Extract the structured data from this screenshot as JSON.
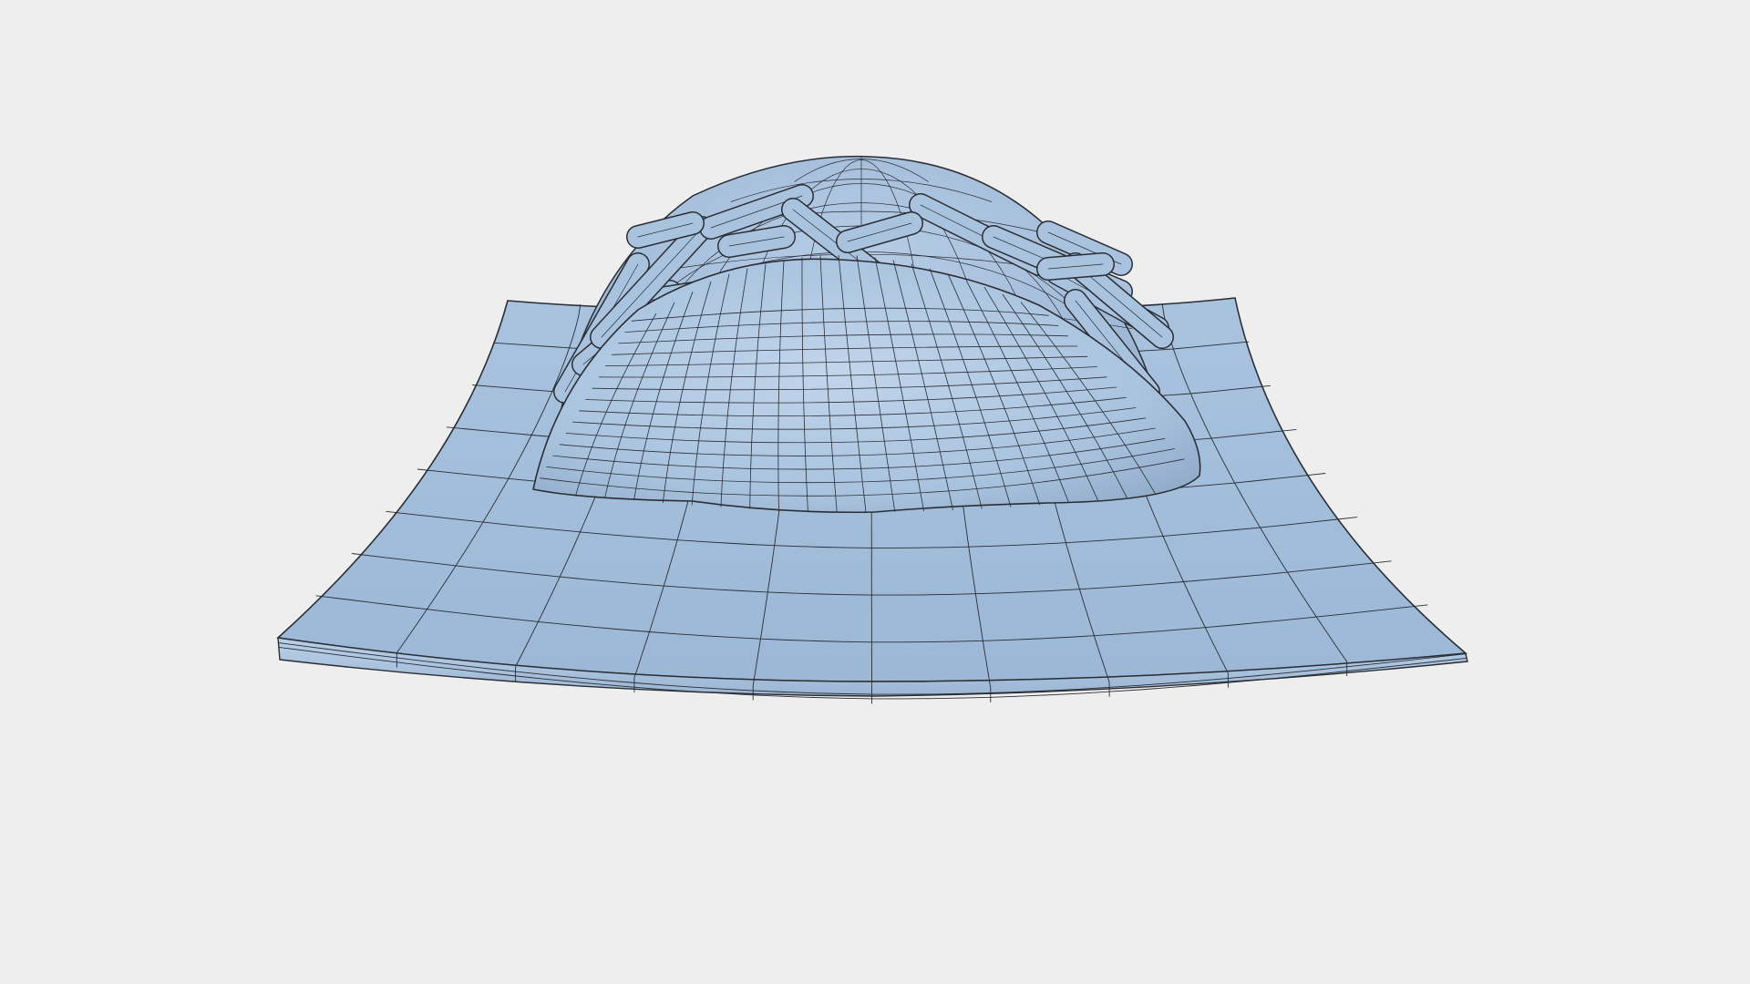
{
  "viewport": {
    "background_color": "#eeeeee",
    "render_mode": "wireframe-on-shaded",
    "view": "perspective"
  },
  "model": {
    "description_visible_text": "",
    "surface_color": "#a6c1de",
    "surface_highlight_color": "#c2d6ec",
    "surface_shadow_color": "#8fa9c6",
    "wire_color": "#23262b",
    "parts": [
      {
        "name": "curved-base-plate"
      },
      {
        "name": "rear-dome-shell"
      },
      {
        "name": "interior-tubes"
      },
      {
        "name": "front-shell-lobe"
      }
    ]
  }
}
